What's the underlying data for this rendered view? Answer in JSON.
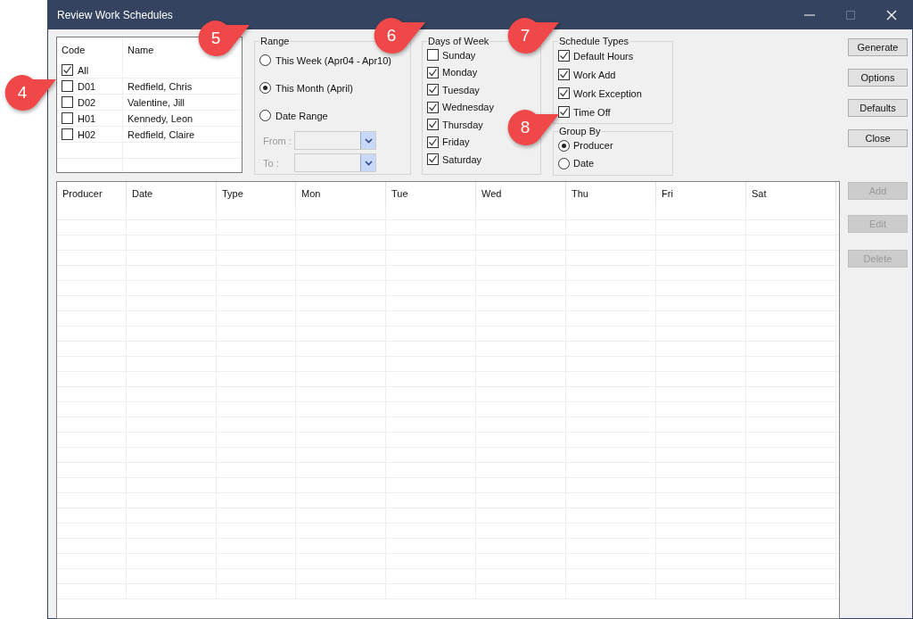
{
  "window": {
    "title": "Review Work Schedules"
  },
  "producers": {
    "columns": [
      "Code",
      "Name"
    ],
    "rows": [
      {
        "code": "All",
        "checked": true
      },
      {
        "code": "D01",
        "name": "Redfield, Chris",
        "checked": false
      },
      {
        "code": "D02",
        "name": "Valentine, Jill",
        "checked": false
      },
      {
        "code": "H01",
        "name": "Kennedy, Leon",
        "checked": false
      },
      {
        "code": "H02",
        "name": "Redfield, Claire",
        "checked": false
      }
    ]
  },
  "range": {
    "title": "Range",
    "options": [
      {
        "label": "This Week (Apr04 - Apr10)",
        "selected": false
      },
      {
        "label": "This Month (April)",
        "selected": true
      },
      {
        "label": "Date Range",
        "selected": false
      }
    ],
    "from_label": "From :",
    "to_label": "To :",
    "disabled": true
  },
  "days_of_week": {
    "title": "Days of Week",
    "items": [
      {
        "label": "Sunday",
        "checked": false
      },
      {
        "label": "Monday",
        "checked": true
      },
      {
        "label": "Tuesday",
        "checked": true
      },
      {
        "label": "Wednesday",
        "checked": true
      },
      {
        "label": "Thursday",
        "checked": true
      },
      {
        "label": "Friday",
        "checked": true
      },
      {
        "label": "Saturday",
        "checked": true
      }
    ]
  },
  "schedule_types": {
    "title": "Schedule Types",
    "items": [
      {
        "label": "Default Hours",
        "checked": true
      },
      {
        "label": "Work Add",
        "checked": true
      },
      {
        "label": "Work Exception",
        "checked": true
      },
      {
        "label": "Time Off",
        "checked": true
      }
    ]
  },
  "group_by": {
    "title": "Group By",
    "options": [
      {
        "label": "Producer",
        "selected": true
      },
      {
        "label": "Date",
        "selected": false
      }
    ]
  },
  "buttons": [
    {
      "label": "Generate",
      "disabled": false
    },
    {
      "label": "Options",
      "disabled": false
    },
    {
      "label": "Defaults",
      "disabled": false
    },
    {
      "label": "Close",
      "disabled": false
    }
  ],
  "grid": {
    "columns": [
      "Producer",
      "Date",
      "Type",
      "Mon",
      "Tue",
      "Wed",
      "Thu",
      "Fri",
      "Sat"
    ]
  },
  "side_buttons": [
    {
      "label": "Add",
      "disabled": true
    },
    {
      "label": "Edit",
      "disabled": true
    },
    {
      "label": "Delete",
      "disabled": true
    }
  ],
  "callouts": [
    "4",
    "5",
    "6",
    "7",
    "8"
  ]
}
